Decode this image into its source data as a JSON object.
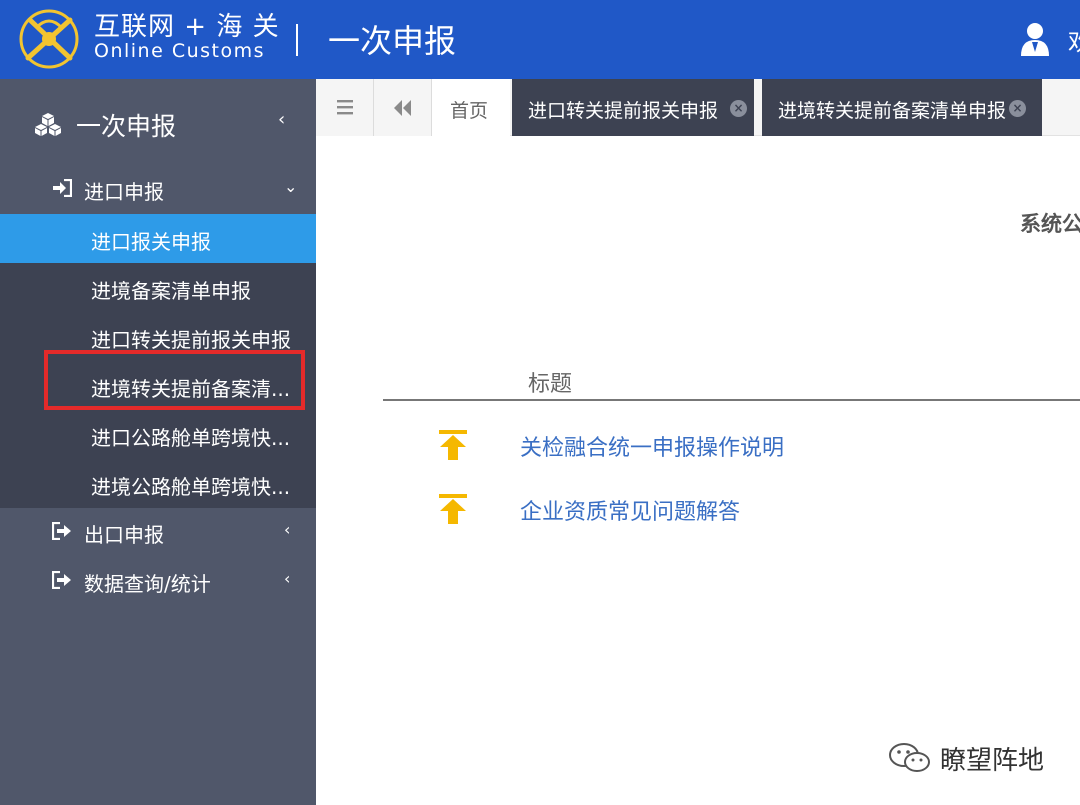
{
  "header": {
    "brand_cn": "互联网 + 海 关",
    "brand_en": "Online Customs",
    "system_title": "一次申报",
    "user_name_partial": "欢",
    "logo_icon": "customs-emblem-icon",
    "user_icon": "user-icon"
  },
  "sidebar": {
    "root": {
      "label": "一次申报",
      "icon": "cubes-icon",
      "chevron": "‹"
    },
    "groups": [
      {
        "label": "进口申报",
        "icon": "sign-in-icon",
        "chevron": "⌄"
      },
      {
        "label": "出口申报",
        "icon": "sign-out-icon",
        "chevron": "‹"
      },
      {
        "label": "数据查询/统计",
        "icon": "sign-out-icon",
        "chevron": "‹"
      }
    ],
    "import_items": [
      {
        "label": "进口报关申报",
        "active": true
      },
      {
        "label": "进境备案清单申报"
      },
      {
        "label": "进口转关提前报关申报"
      },
      {
        "label": "进境转关提前备案清..."
      },
      {
        "label": "进口公路舱单跨境快..."
      },
      {
        "label": "进境公路舱单跨境快..."
      }
    ]
  },
  "tabbar": {
    "menu_icon": "≡",
    "back_icon": "«",
    "tabs": [
      {
        "label": "首页"
      },
      {
        "label": "进口转关提前报关申报"
      },
      {
        "label": "进境转关提前备案清单申报"
      }
    ],
    "close_glyph": "×"
  },
  "main": {
    "notice_title": "系统公",
    "column_header": "标题",
    "notices": [
      {
        "label": "关检融合统一申报操作说明",
        "icon": "pin-top-icon"
      },
      {
        "label": "企业资质常见问题解答",
        "icon": "pin-top-icon"
      }
    ]
  },
  "watermark": {
    "text": "瞭望阵地",
    "icon": "wechat-icon"
  },
  "colors": {
    "header_bg": "#2058c7",
    "sidebar_bg": "#50576a",
    "submenu_bg": "#3d4252",
    "active_item": "#2e9be8",
    "highlight": "#e52a2a",
    "link": "#3a6fc4",
    "pin_icon": "#f5b800"
  }
}
